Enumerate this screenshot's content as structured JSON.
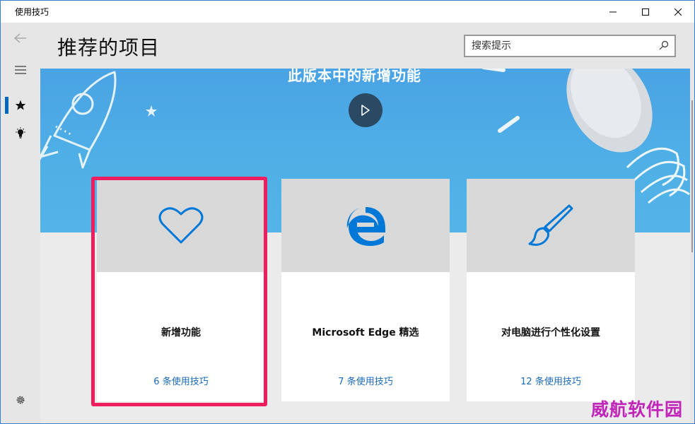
{
  "window": {
    "title": "使用技巧",
    "controls": [
      "minimize-icon",
      "maximize-icon",
      "close-icon"
    ]
  },
  "nav": {
    "items": [
      {
        "icon": "back-arrow-icon",
        "interactable": true
      },
      {
        "icon": "hamburger-menu-icon",
        "interactable": true
      },
      {
        "icon": "star-icon",
        "selected": true
      },
      {
        "icon": "lightbulb-icon"
      },
      {
        "icon": "settings-gear-icon"
      }
    ]
  },
  "header": {
    "page_title": "推荐的项目",
    "search_placeholder": "搜索提示"
  },
  "banner": {
    "title": "此版本中的新增功能",
    "play_icon": "play-icon",
    "colors": {
      "bg": "#4aa3e4",
      "play": "#2a4a64"
    }
  },
  "cards": [
    {
      "title": "新增功能",
      "count": "6 条使用技巧",
      "icon": "heart-icon",
      "highlighted": true
    },
    {
      "title": "Microsoft Edge 精选",
      "count": "7 条使用技巧",
      "icon": "edge-logo-icon"
    },
    {
      "title": "对电脑进行个性化设置",
      "count": "12 条使用技巧",
      "icon": "paintbrush-icon"
    }
  ],
  "accent_color": "#0067c0",
  "highlight_color": "#ee1d5e",
  "watermark": "威航软件园"
}
